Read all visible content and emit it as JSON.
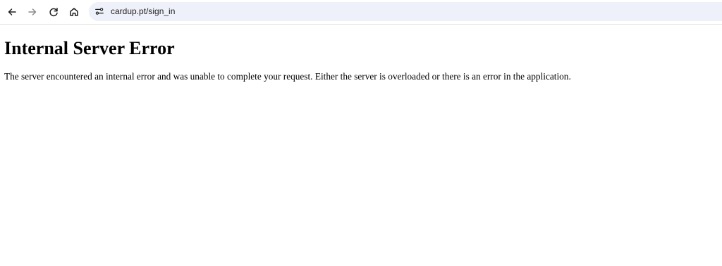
{
  "browser": {
    "url": "cardup.pt/sign_in",
    "icons": {
      "back": "back-arrow-icon",
      "forward": "forward-arrow-icon",
      "reload": "reload-icon",
      "home": "home-icon",
      "site_info": "site-settings-icon"
    },
    "colors": {
      "omnibox_bg": "#eef1f9",
      "icon": "#1f1f1f",
      "icon_disabled": "#8a8a8a"
    }
  },
  "page": {
    "heading": "Internal Server Error",
    "message": "The server encountered an internal error and was unable to complete your request. Either the server is overloaded or there is an error in the application."
  }
}
